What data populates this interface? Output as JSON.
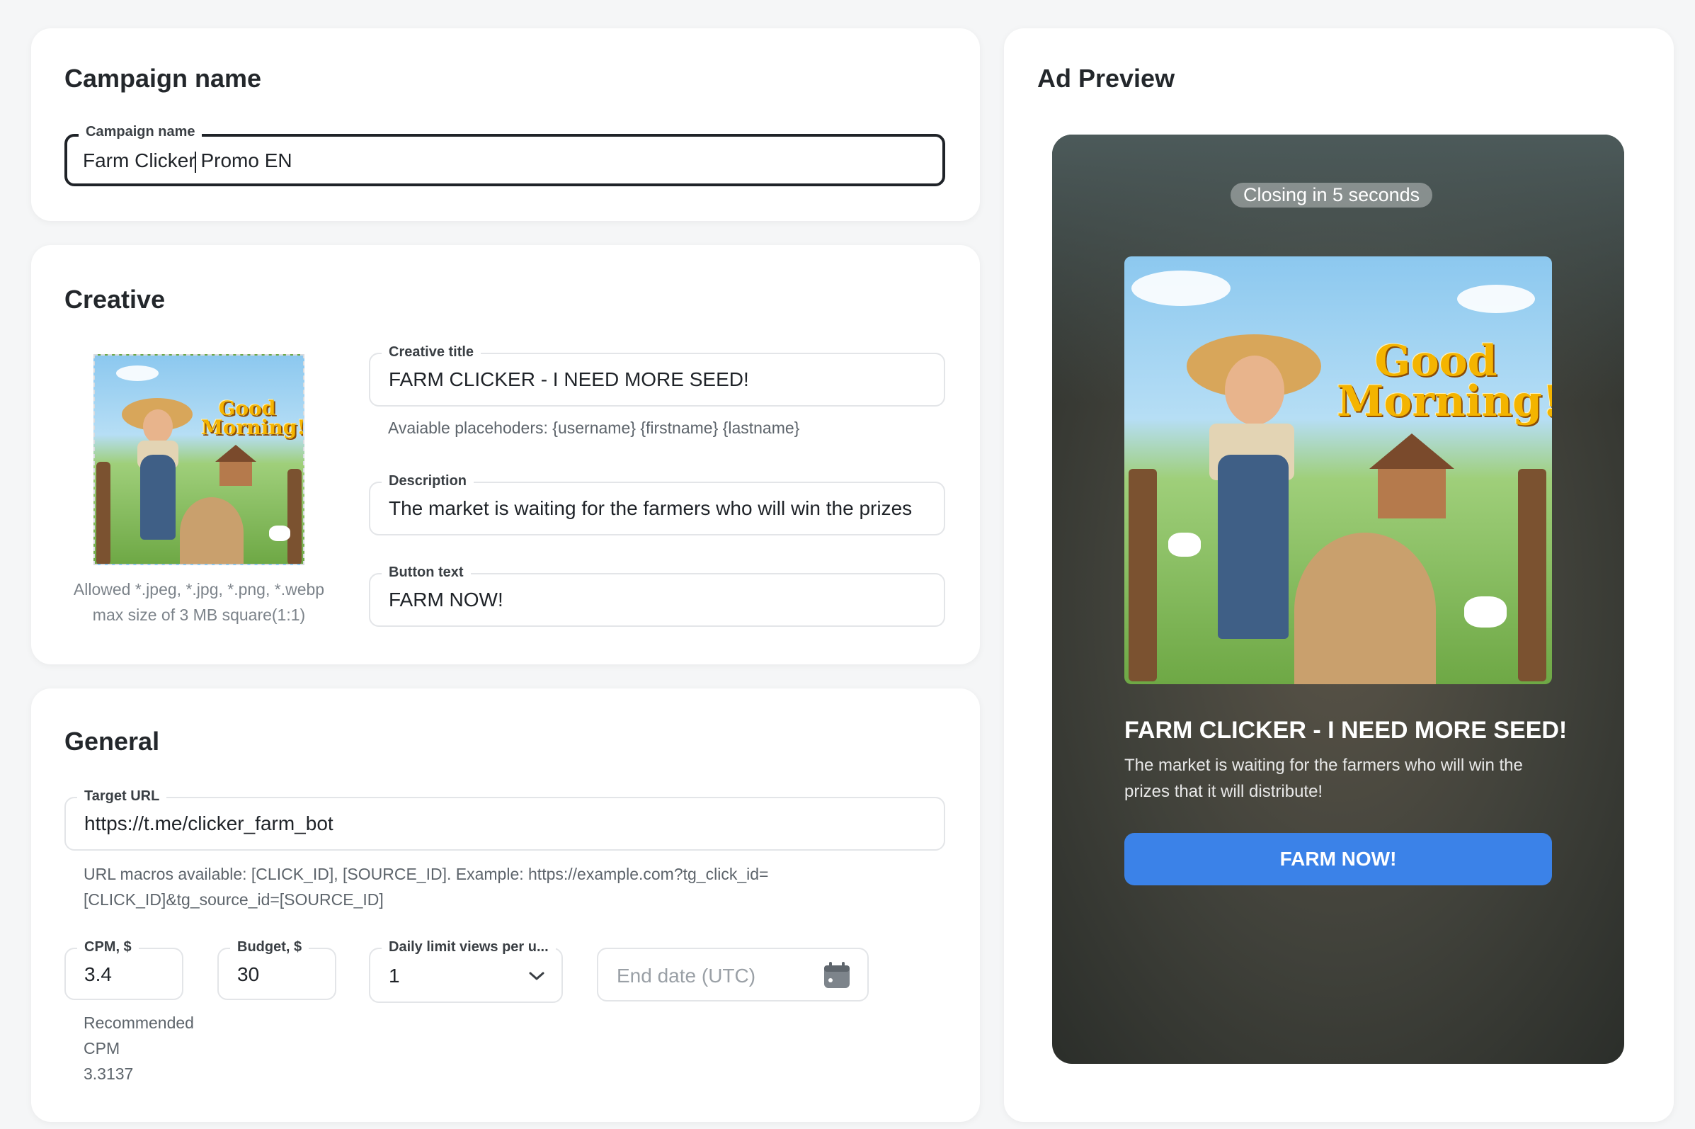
{
  "campaign": {
    "section_title": "Campaign name",
    "field_label": "Campaign name",
    "value_before_caret": "Farm Clicker",
    "value_after_caret": " Promo EN"
  },
  "creative": {
    "section_title": "Creative",
    "image_hint_line1": "Allowed *.jpeg, *.jpg, *.png, *.webp",
    "image_hint_line2": "max size of 3 MB square(1:1)",
    "image_text": "Good Morning!",
    "title_label": "Creative title",
    "title_value": "FARM CLICKER - I NEED MORE SEED!",
    "placeholders_hint": "Avaiable placehoders: {username} {firstname} {lastname}",
    "description_label": "Description",
    "description_value": "The market is waiting for the farmers who will win the prizes",
    "button_label": "Button text",
    "button_value": "FARM NOW!"
  },
  "general": {
    "section_title": "General",
    "target_url_label": "Target URL",
    "target_url_value": "https://t.me/clicker_farm_bot",
    "url_macros_line1": "URL macros available: [CLICK_ID], [SOURCE_ID]. Example: https://example.com?tg_click_id=",
    "url_macros_line2": "[CLICK_ID]&tg_source_id=[SOURCE_ID]",
    "cpm_label": "CPM, $",
    "cpm_value": "3.4",
    "budget_label": "Budget, $",
    "budget_value": "30",
    "daily_limit_label": "Daily limit views per u...",
    "daily_limit_value": "1",
    "end_date_placeholder": "End date (UTC)",
    "recommended_line1": "Recommended",
    "recommended_line2": "CPM",
    "recommended_line3": "3.3137"
  },
  "preview": {
    "section_title": "Ad Preview",
    "closing_text": "Closing in 5 seconds",
    "image_text": "Good Morning!",
    "ad_title": "FARM CLICKER - I NEED MORE SEED!",
    "ad_desc_line1": "The market is waiting for the farmers who will win the",
    "ad_desc_line2": "prizes that it will distribute!",
    "ad_button": "FARM NOW!"
  },
  "icons": {
    "calendar": "calendar-icon",
    "chevron": "chevron-down-icon"
  },
  "colors": {
    "accent_button": "#3b82e8",
    "active_border": "#1f2328",
    "page_background": "#f5f6f7"
  }
}
